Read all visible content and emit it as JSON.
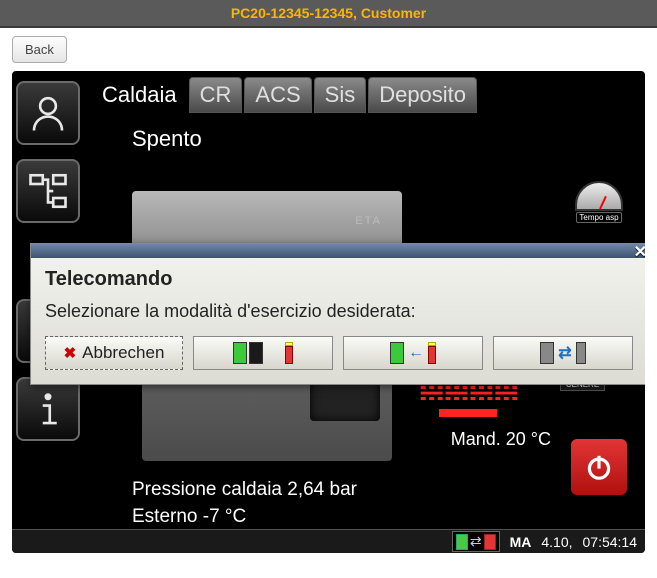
{
  "title": "PC20-12345-12345, Customer",
  "back_label": "Back",
  "tabs": {
    "caldaia": "Caldaia",
    "cr": "CR",
    "acs": "ACS",
    "sis": "Sis",
    "deposito": "Deposito"
  },
  "status": "Spento",
  "boiler_brand": "ETA",
  "tempo_label": "Tempo asp",
  "cenere_label": "CENERE",
  "mand_label": "Mand. 20 °C",
  "pressure_label": "Pressione caldaia 2,64 bar",
  "esterno_label": "Esterno -7 °C",
  "statusbar": {
    "day": "MA",
    "date": "4.10,",
    "time": "07:54:14"
  },
  "dialog": {
    "title": "Telecomando",
    "text": "Selezionare la modalità d'esercizio desiderata:",
    "cancel": "Abbrechen"
  }
}
